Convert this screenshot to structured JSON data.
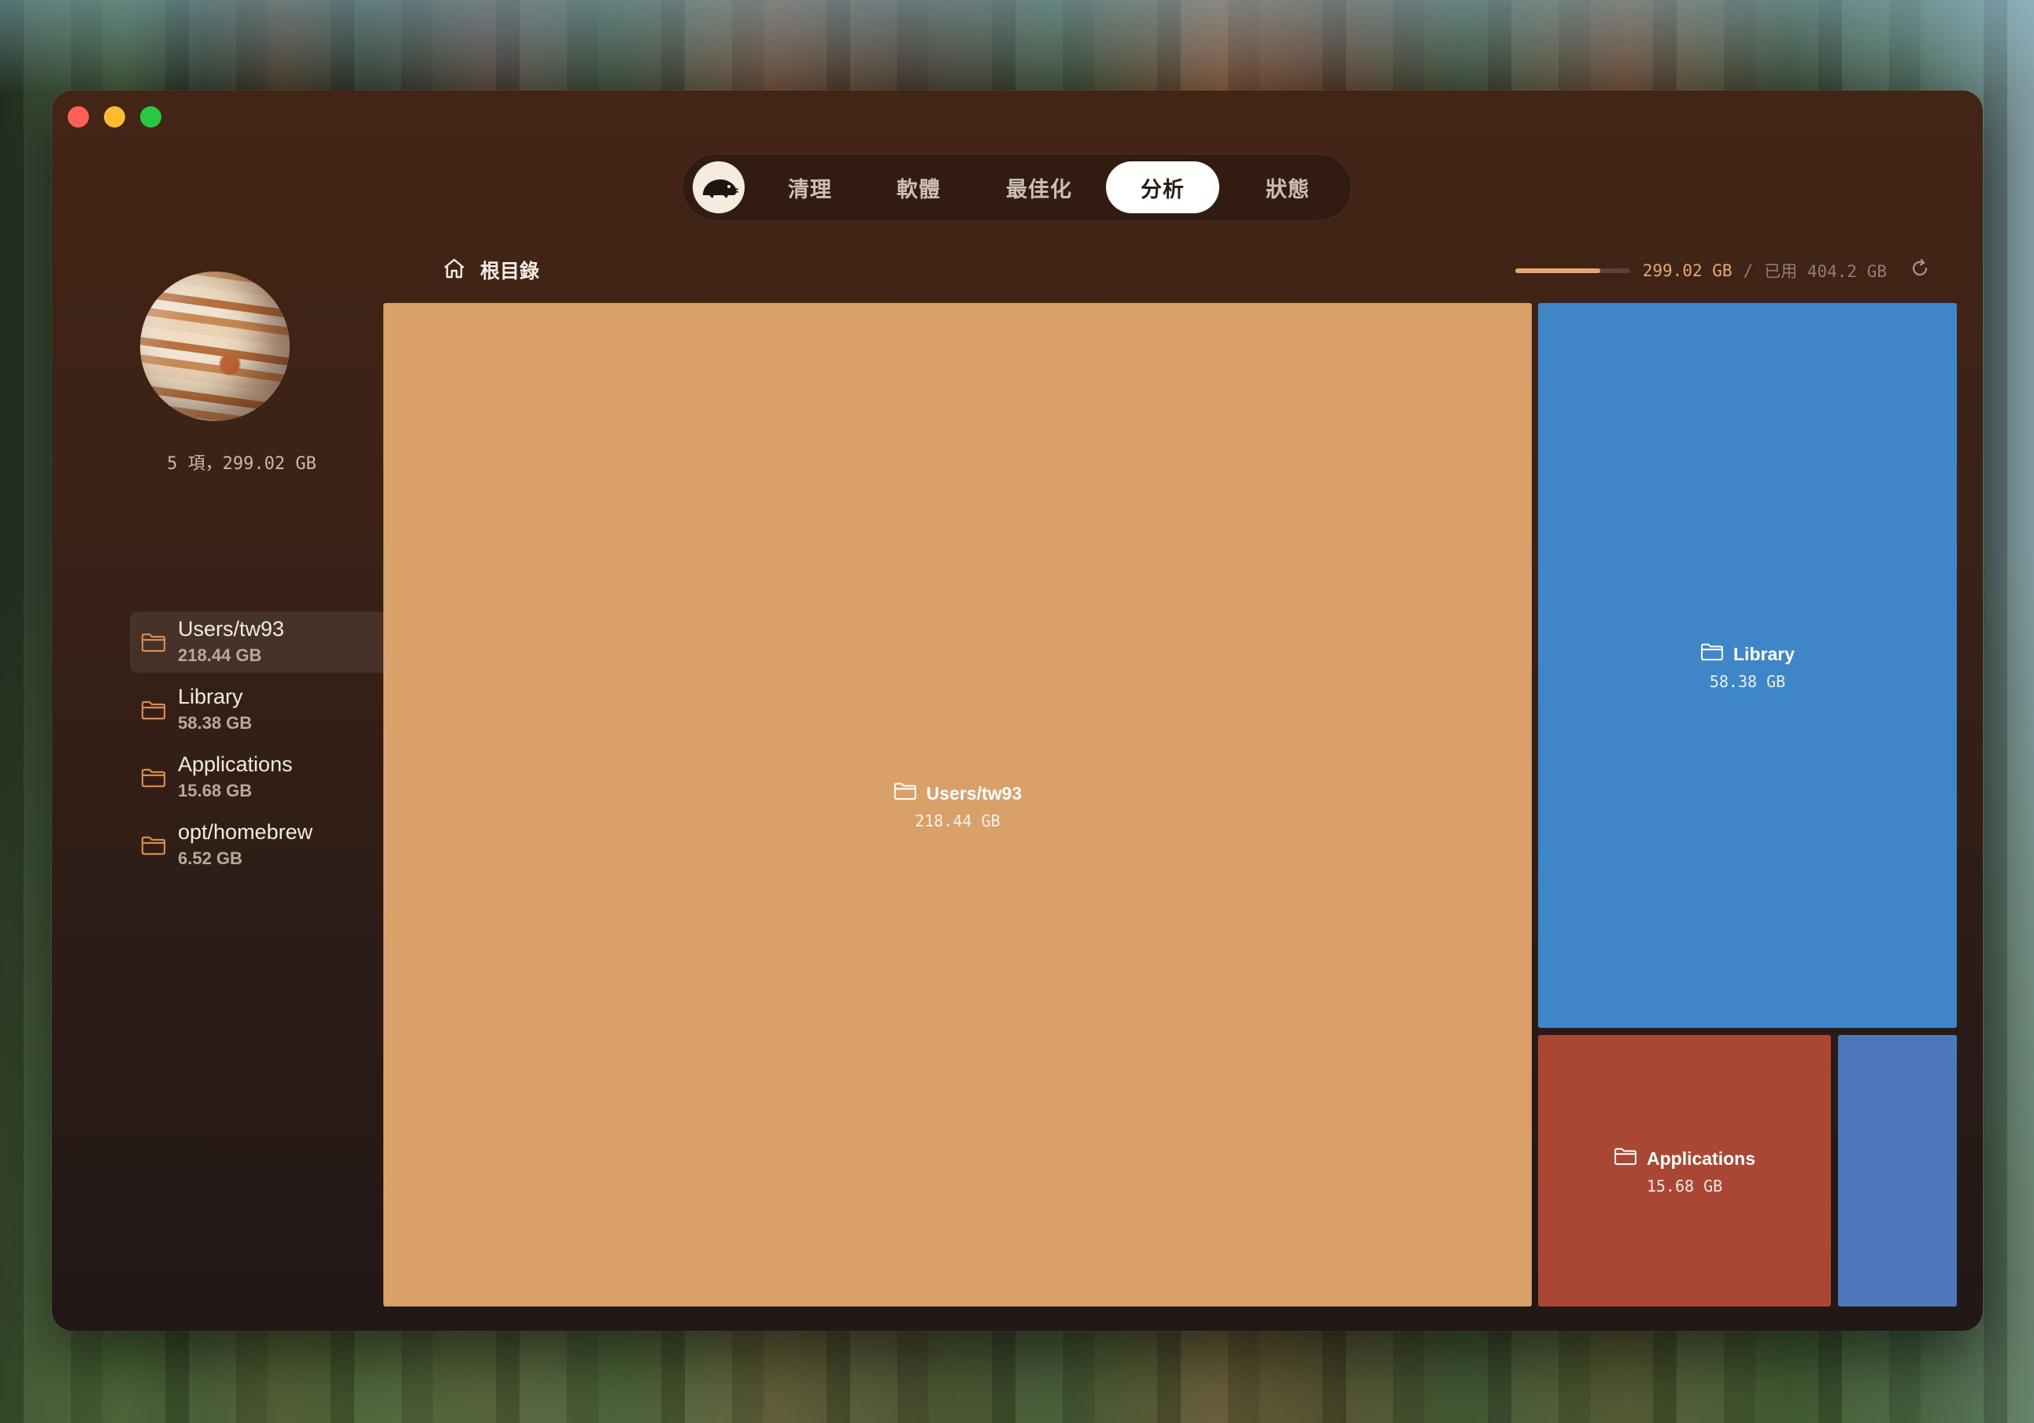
{
  "nav": {
    "tabs": [
      {
        "label": "清理"
      },
      {
        "label": "軟體"
      },
      {
        "label": "最佳化"
      },
      {
        "label": "分析",
        "active": true
      },
      {
        "label": "狀態"
      }
    ]
  },
  "sidebar": {
    "summary": "5 項，299.02 GB",
    "items": [
      {
        "name": "Users/tw93",
        "size": "218.44 GB",
        "selected": true
      },
      {
        "name": "Library",
        "size": "58.38 GB"
      },
      {
        "name": "Applications",
        "size": "15.68 GB"
      },
      {
        "name": "opt/homebrew",
        "size": "6.52 GB"
      }
    ]
  },
  "header": {
    "breadcrumb": "根目錄",
    "used": "299.02 GB",
    "separator": "/",
    "total": "已用 404.2 GB",
    "usage_fraction": 0.74
  },
  "treemap": {
    "tiles": [
      {
        "name": "Users/tw93",
        "size": "218.44 GB",
        "color": "#d9a06a"
      },
      {
        "name": "Library",
        "size": "58.38 GB",
        "color": "#3f86c8"
      },
      {
        "name": "Applications",
        "size": "15.68 GB",
        "color": "#a94634"
      },
      {
        "color": "#4c77b8"
      }
    ]
  },
  "colors": {
    "accent": "#e6a772",
    "folder_icon": "#d98a4e"
  }
}
